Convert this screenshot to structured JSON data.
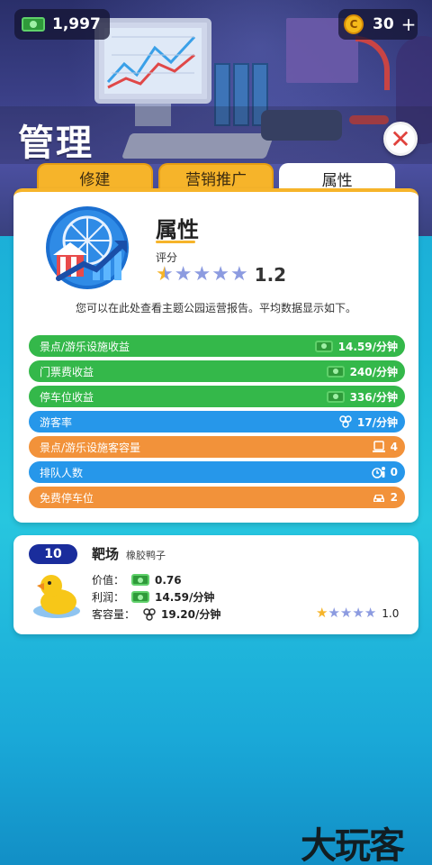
{
  "header": {
    "money": "1,997",
    "coins": "30",
    "coin_symbol": "C",
    "coin_plus": "+",
    "page_title": "管理",
    "close_symbol": "✕"
  },
  "tabs": [
    {
      "label": "修建",
      "active": false
    },
    {
      "label": "营销推广",
      "active": false
    },
    {
      "label": "属性",
      "active": true
    }
  ],
  "attributes": {
    "title": "属性",
    "rating_label": "评分",
    "rating_value": "1.2",
    "description": "您可以在此处查看主题公园运营报告。平均数据显示如下。",
    "stats": [
      {
        "label": "景点/游乐设施收益",
        "value": "14.59/分钟",
        "color": "green",
        "icon": "money-icon"
      },
      {
        "label": "门票费收益",
        "value": "240/分钟",
        "color": "green",
        "icon": "money-icon"
      },
      {
        "label": "停车位收益",
        "value": "336/分钟",
        "color": "green",
        "icon": "money-icon"
      },
      {
        "label": "游客率",
        "value": "17/分钟",
        "color": "blue",
        "icon": "visitors-icon"
      },
      {
        "label": "景点/游乐设施客容量",
        "value": "4",
        "color": "orange",
        "icon": "capacity-icon"
      },
      {
        "label": "排队人数",
        "value": "0",
        "color": "blue",
        "icon": "queue-icon"
      },
      {
        "label": "免费停车位",
        "value": "2",
        "color": "orange",
        "icon": "car-icon"
      }
    ]
  },
  "ride": {
    "level": "10",
    "name": "靶场",
    "subtitle": "橡胶鸭子",
    "value_label": "价值：",
    "value": "0.76",
    "profit_label": "利润：",
    "profit": "14.59/分钟",
    "capacity_label": "客容量：",
    "capacity": "19.20/分钟",
    "rating": "1.0"
  },
  "watermark": "大玩客",
  "colors": {
    "green": "#34b84a",
    "blue": "#2697ea",
    "orange": "#f2923a",
    "tab": "#f6b42a",
    "badge": "#1a2d9c"
  }
}
